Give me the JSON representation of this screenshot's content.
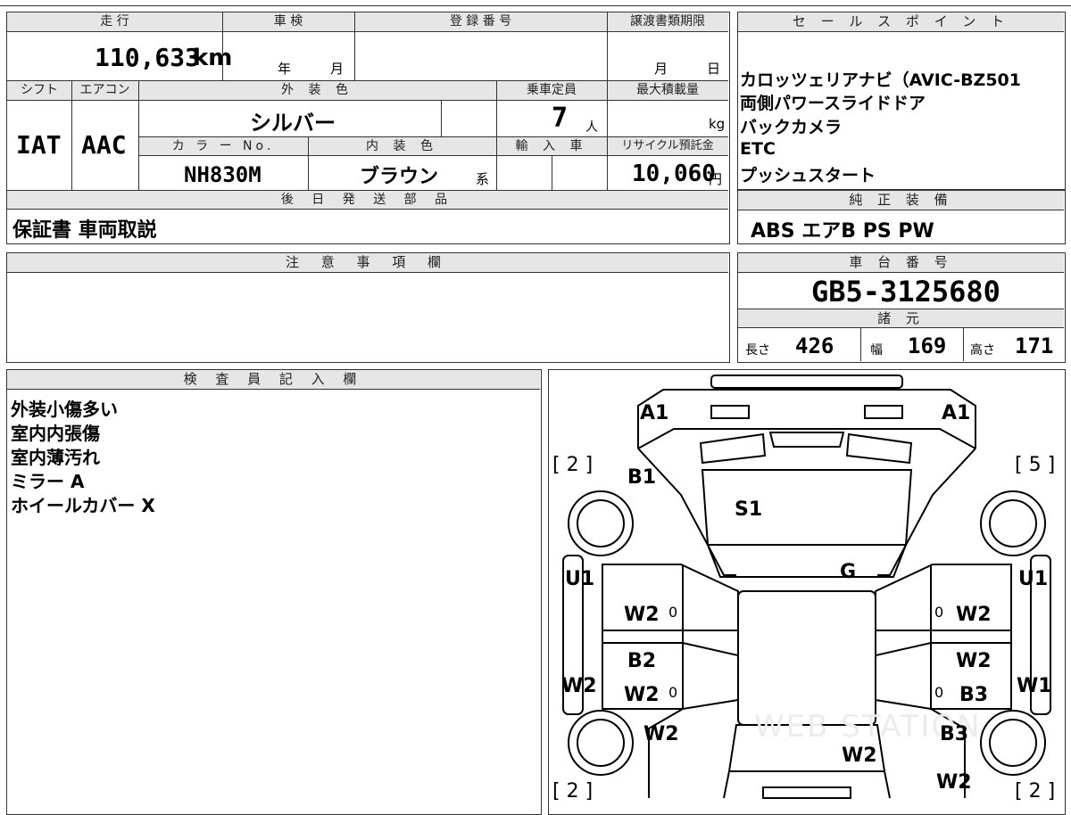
{
  "info": {
    "mileage_header": "走 行",
    "mileage": "110,633",
    "mileage_unit": "km",
    "inspection_header": "車 検",
    "inspection_year": "年",
    "inspection_month": "月",
    "registration_header": "登 録 番 号",
    "transfer_header": "譲渡書類期限",
    "transfer_month": "月",
    "transfer_day": "日",
    "shift_header": "シフト",
    "ac_header": "エアコン",
    "shift": "IAT",
    "ac": "AAC",
    "exterior_header": "外 装 色",
    "exterior_color": "シルバー",
    "capacity_header": "乗車定員",
    "capacity": "7",
    "capacity_unit": "人",
    "load_header": "最大積載量",
    "load_unit": "kg",
    "color_no_header": "カ ラ ー No.",
    "color_no": "NH830M",
    "interior_header": "内 装 色",
    "interior_color": "ブラウン",
    "interior_suffix": "系",
    "import_header": "輸 入 車",
    "recycle_header": "リサイクル預託金",
    "recycle_amount": "10,060",
    "recycle_unit": "円",
    "later_parts_header": "後 日 発 送 部 品",
    "later_parts": "保証書 車両取説"
  },
  "sales": {
    "header": "セ ー ル ス ポ イ ン ト",
    "points": [
      "カロッツェリアナビ（AVIC-BZ501",
      "両側パワースライドドア",
      "バックカメラ",
      "ETC",
      "プッシュスタート"
    ]
  },
  "equipment": {
    "header": "純 正 装 備",
    "value": "ABS エアB PS PW"
  },
  "notes": {
    "header": "注 意 事 項 欄"
  },
  "chassis": {
    "header": "車 台 番 号",
    "number": "GB5-3125680",
    "spec_header": "諸 元",
    "length_label": "長さ",
    "length": "426",
    "width_label": "幅",
    "width": "169",
    "height_label": "高さ",
    "height": "171"
  },
  "inspector": {
    "header": "検 査 員 記 入 欄",
    "lines": [
      "外装小傷多い",
      "室内内張傷",
      "室内薄汚れ",
      "ミラー A",
      "ホイールカバー X"
    ]
  },
  "diagram": {
    "watermark": "WEB STATION",
    "marks": {
      "a1_left": "A1",
      "a1_right": "A1",
      "tire_fl": "[ 2 ]",
      "tire_fr": "[ 5 ]",
      "tire_rl": "[ 2 ]",
      "tire_rr": "[ 2 ]",
      "b1": "B1",
      "s1": "S1",
      "g": "G",
      "u1_left": "U1",
      "u1_right": "U1",
      "w2_front_left_door": "W2",
      "w2_front_right_door": "W2",
      "zero_1": "0",
      "zero_2": "0",
      "zero_3": "0",
      "zero_4": "0",
      "b2": "B2",
      "w2_right_mid": "W2",
      "w2_left_side": "W2",
      "w2_rear_left_door": "W2",
      "b3_door": "B3",
      "w1_right_side": "W1",
      "w2_left_rear": "W2",
      "b3_rear": "B3",
      "w2_roof_rear": "W2",
      "w2_right_rear": "W2"
    }
  }
}
